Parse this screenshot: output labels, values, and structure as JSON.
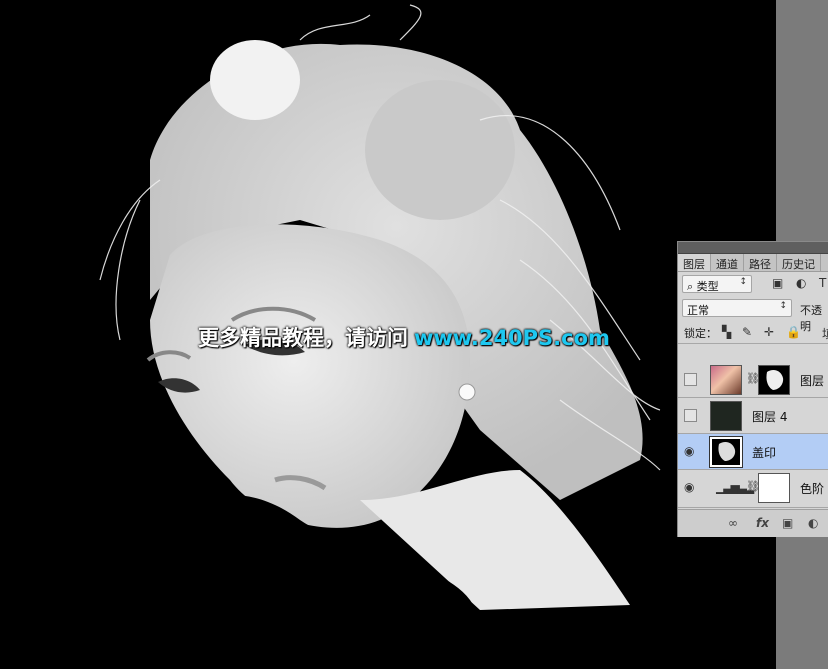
{
  "watermark": {
    "cn_text": "更多精品教程，请访问",
    "url_text": "www.240PS.com",
    "url_color": "#1ec8f0"
  },
  "layers_panel": {
    "tabs": [
      {
        "label": "图层",
        "active": true
      },
      {
        "label": "通道",
        "active": false
      },
      {
        "label": "路径",
        "active": false
      },
      {
        "label": "历史记",
        "active": false
      }
    ],
    "filter": {
      "icon": "search-icon",
      "value": "类型"
    },
    "blend_mode": {
      "value": "正常"
    },
    "opacity_label": "不透明",
    "lock_label": "锁定：",
    "fill_label": "填",
    "layers": [
      {
        "name": "图层",
        "visible": false,
        "selected": false,
        "has_mask": true,
        "thumb": "portrait-color"
      },
      {
        "name": "图层 4",
        "visible": false,
        "selected": false,
        "has_mask": false,
        "thumb": "dark-fill"
      },
      {
        "name": "盖印",
        "visible": true,
        "selected": true,
        "has_mask": false,
        "thumb": "portrait-bw"
      },
      {
        "name": "色阶",
        "visible": true,
        "selected": false,
        "has_mask": true,
        "thumb": "levels-adjustment"
      }
    ],
    "footer_icons": [
      "link-icon",
      "fx-icon",
      "mask-icon",
      "adjustment-icon"
    ]
  },
  "colors": {
    "canvas_bg": "#000000",
    "panel_bg": "#d6d6d6",
    "selected_row": "#b3cdf5",
    "gutter": "#7b7b7b"
  }
}
